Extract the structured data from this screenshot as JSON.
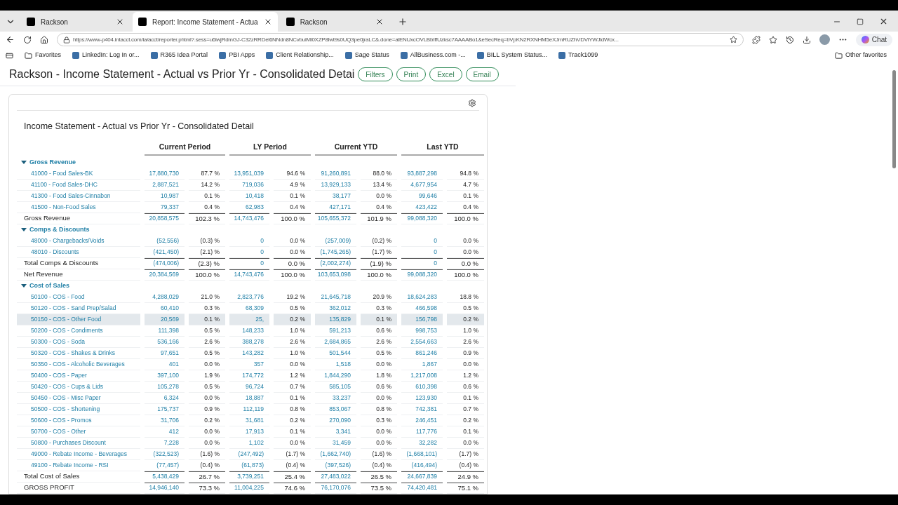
{
  "browser": {
    "tabs": [
      {
        "label": "Rackson",
        "selected": false
      },
      {
        "label": "Report: Income Statement - Actua",
        "selected": true
      },
      {
        "label": "Rackson",
        "selected": false
      }
    ],
    "url": "https://www-p404.intacct.com/ia/acct/reporter.phtml?.sess=u6lwjRdmGJ-C32zRRDel6NNdn8NCvbuiMl0XZP8lwt9s0UQ3pe0jraLC&.done=alENUxcOVLBbIffUzksc7AAAABo1&eSecReq=bVpKN2RXNHM5eXJmRUZhVDViYWJldWcx...",
    "chat": "Chat",
    "bookmarks": [
      "Favorites",
      "LinkedIn: Log In or...",
      "R365 Idea Portal",
      "PBI Apps",
      "Client Relationship...",
      "Sage Status",
      "AllBusiness.com -...",
      "BILL System Status...",
      "Track1099"
    ],
    "other_favorites": "Other favorites"
  },
  "page": {
    "title": "Rackson - Income Statement - Actual vs Prior Yr - Consolidated Detai",
    "buttons": [
      "Filters",
      "Print",
      "Excel",
      "Email"
    ]
  },
  "report": {
    "title": "Income Statement - Actual vs Prior Yr - Consolidated Detail",
    "columns": [
      "Current Period",
      "LY Period",
      "Current YTD",
      "Last YTD"
    ],
    "rows": [
      {
        "kind": "group",
        "label": "Gross Revenue",
        "expanded": true
      },
      {
        "kind": "account",
        "label": "41000 - Food Sales-BK",
        "selected": false,
        "cells": [
          "17,880,730",
          "87.7 %",
          "13,951,039",
          "94.6 %",
          "91,260,891",
          "88.0 %",
          "93,887,298",
          "94.8 %"
        ]
      },
      {
        "kind": "account",
        "label": "41100 - Food Sales-DHC",
        "selected": false,
        "cells": [
          "2,887,521",
          "14.2 %",
          "719,036",
          "4.9 %",
          "13,929,133",
          "13.4 %",
          "4,677,954",
          "4.7 %"
        ]
      },
      {
        "kind": "account",
        "label": "41300 - Food Sales-Cinnabon",
        "selected": false,
        "cells": [
          "10,987",
          "0.1 %",
          "10,418",
          "0.1 %",
          "38,177",
          "0.0 %",
          "99,646",
          "0.1 %"
        ]
      },
      {
        "kind": "account",
        "label": "41500 - Non-Food Sales",
        "selected": false,
        "cells": [
          "79,337",
          "0.4 %",
          "62,983",
          "0.4 %",
          "427,171",
          "0.4 %",
          "423,422",
          "0.4 %"
        ]
      },
      {
        "kind": "total",
        "label": "Gross Revenue",
        "selected": false,
        "cells": [
          "20,858,575",
          "102.3 %",
          "14,743,476",
          "100.0 %",
          "105,655,372",
          "101.9 %",
          "99,088,320",
          "100.0 %"
        ]
      },
      {
        "kind": "group",
        "label": "Comps & Discounts",
        "expanded": true
      },
      {
        "kind": "account",
        "label": "48000 - Chargebacks/Voids",
        "selected": false,
        "cells": [
          "(52,556)",
          "(0.3) %",
          "0",
          "0.0 %",
          "(257,009)",
          "(0.2) %",
          "0",
          "0.0 %"
        ]
      },
      {
        "kind": "account",
        "label": "48010 - Discounts",
        "selected": false,
        "cells": [
          "(421,450)",
          "(2.1) %",
          "0",
          "0.0 %",
          "(1,745,265)",
          "(1.7) %",
          "0",
          "0.0 %"
        ]
      },
      {
        "kind": "total",
        "label": "Total Comps & Discounts",
        "selected": false,
        "cells": [
          "(474,006)",
          "(2.3) %",
          "0",
          "0.0 %",
          "(2,002,274)",
          "(1.9) %",
          "0",
          "0.0 %"
        ]
      },
      {
        "kind": "total",
        "label": "Net Revenue",
        "selected": false,
        "cells": [
          "20,384,569",
          "100.0 %",
          "14,743,476",
          "100.0 %",
          "103,653,098",
          "100.0 %",
          "99,088,320",
          "100.0 %"
        ]
      },
      {
        "kind": "group",
        "label": "Cost of Sales",
        "expanded": true
      },
      {
        "kind": "account",
        "label": "50100 - COS - Food",
        "selected": false,
        "cells": [
          "4,288,029",
          "21.0 %",
          "2,823,776",
          "19.2 %",
          "21,645,718",
          "20.9 %",
          "18,624,283",
          "18.8 %"
        ]
      },
      {
        "kind": "account",
        "label": "50120 - COS - Sand Prep/Salad",
        "selected": false,
        "cells": [
          "60,410",
          "0.3 %",
          "68,309",
          "0.5 %",
          "362,012",
          "0.3 %",
          "466,598",
          "0.5 %"
        ]
      },
      {
        "kind": "account",
        "label": "50150 - COS - Other Food",
        "selected": true,
        "cells": [
          "20,569",
          "0.1 %",
          "25,",
          "0.2 %",
          "135,829",
          "0.1 %",
          "156,798",
          "0.2 %"
        ]
      },
      {
        "kind": "account",
        "label": "50200 - COS - Condiments",
        "selected": false,
        "cells": [
          "111,398",
          "0.5 %",
          "148,233",
          "1.0 %",
          "591,213",
          "0.6 %",
          "998,753",
          "1.0 %"
        ]
      },
      {
        "kind": "account",
        "label": "50300 - COS - Soda",
        "selected": false,
        "cells": [
          "536,166",
          "2.6 %",
          "388,278",
          "2.6 %",
          "2,684,865",
          "2.6 %",
          "2,554,663",
          "2.6 %"
        ]
      },
      {
        "kind": "account",
        "label": "50320 - COS - Shakes & Drinks",
        "selected": false,
        "cells": [
          "97,651",
          "0.5 %",
          "143,282",
          "1.0 %",
          "501,544",
          "0.5 %",
          "861,246",
          "0.9 %"
        ]
      },
      {
        "kind": "account",
        "label": "50350 - COS - Alcoholic Beverages",
        "selected": false,
        "cells": [
          "401",
          "0.0 %",
          "357",
          "0.0 %",
          "1,518",
          "0.0 %",
          "1,867",
          "0.0 %"
        ]
      },
      {
        "kind": "account",
        "label": "50400 - COS - Paper",
        "selected": false,
        "cells": [
          "397,100",
          "1.9 %",
          "174,772",
          "1.2 %",
          "1,844,290",
          "1.8 %",
          "1,217,008",
          "1.2 %"
        ]
      },
      {
        "kind": "account",
        "label": "50420 - COS - Cups & Lids",
        "selected": false,
        "cells": [
          "105,278",
          "0.5 %",
          "96,724",
          "0.7 %",
          "585,105",
          "0.6 %",
          "610,398",
          "0.6 %"
        ]
      },
      {
        "kind": "account",
        "label": "50450 - COS - Misc Paper",
        "selected": false,
        "cells": [
          "6,324",
          "0.0 %",
          "18,887",
          "0.1 %",
          "33,237",
          "0.0 %",
          "123,930",
          "0.1 %"
        ]
      },
      {
        "kind": "account",
        "label": "50500 - COS - Shortening",
        "selected": false,
        "cells": [
          "175,737",
          "0.9 %",
          "112,119",
          "0.8 %",
          "853,067",
          "0.8 %",
          "742,381",
          "0.7 %"
        ]
      },
      {
        "kind": "account",
        "label": "50600 - COS - Promos",
        "selected": false,
        "cells": [
          "31,706",
          "0.2 %",
          "31,681",
          "0.2 %",
          "270,090",
          "0.3 %",
          "246,451",
          "0.2 %"
        ]
      },
      {
        "kind": "account",
        "label": "50700 - COS - Other",
        "selected": false,
        "cells": [
          "412",
          "0.0 %",
          "17,913",
          "0.1 %",
          "3,341",
          "0.0 %",
          "117,776",
          "0.1 %"
        ]
      },
      {
        "kind": "account",
        "label": "50800 - Purchases Discount",
        "selected": false,
        "cells": [
          "7,228",
          "0.0 %",
          "1,102",
          "0.0 %",
          "31,459",
          "0.0 %",
          "32,282",
          "0.0 %"
        ]
      },
      {
        "kind": "account",
        "label": "49000 - Rebate Income - Beverages",
        "selected": false,
        "cells": [
          "(322,523)",
          "(1.6) %",
          "(247,492)",
          "(1.7) %",
          "(1,662,740)",
          "(1.6) %",
          "(1,668,101)",
          "(1.7) %"
        ]
      },
      {
        "kind": "account",
        "label": "49100 - Rebate Income - RSI",
        "selected": false,
        "cells": [
          "(77,457)",
          "(0.4) %",
          "(61,873)",
          "(0.4) %",
          "(397,526)",
          "(0.4) %",
          "(416,494)",
          "(0.4) %"
        ]
      },
      {
        "kind": "total",
        "label": "Total Cost of Sales",
        "selected": false,
        "cells": [
          "5,438,429",
          "26.7 %",
          "3,739,251",
          "25.4 %",
          "27,483,022",
          "26.5 %",
          "24,667,839",
          "24.9 %"
        ]
      },
      {
        "kind": "total",
        "label": "GROSS PROFIT",
        "selected": false,
        "cells": [
          "14,946,140",
          "73.3 %",
          "11,004,225",
          "74.6 %",
          "76,170,076",
          "73.5 %",
          "74,420,481",
          "75.1 %"
        ]
      }
    ]
  }
}
